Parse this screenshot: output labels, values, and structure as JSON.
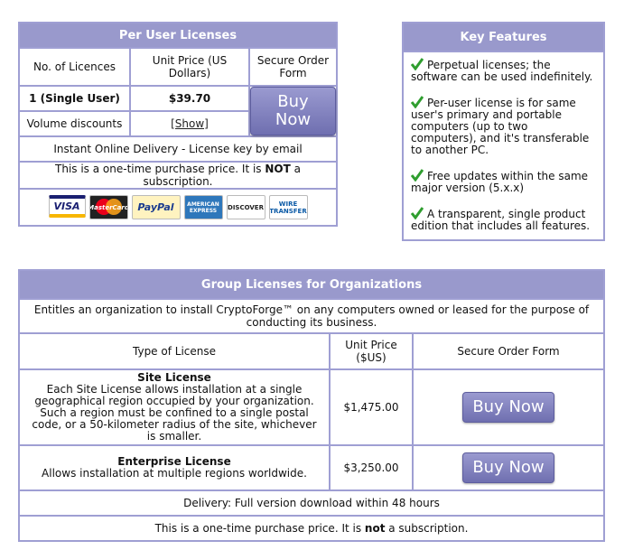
{
  "per_user": {
    "title": "Per User Licenses",
    "col_licences": "No. of Licences",
    "col_unit_price": "Unit Price (US Dollars)",
    "col_order": "Secure Order Form",
    "row_label": "1 (Single User)",
    "row_price": "$39.70",
    "buy_label": "Buy Now",
    "volume_label": "Volume discounts",
    "show_link": "[Show]",
    "delivery": "Instant Online Delivery - License key by email",
    "onetime_pre": "This is a one-time purchase price. It is ",
    "onetime_bold": "NOT",
    "onetime_post": " a subscription.",
    "payment_logos": [
      {
        "icon": "visa-logo",
        "text": "VISA"
      },
      {
        "icon": "mastercard-logo",
        "text": "MasterCard"
      },
      {
        "icon": "paypal-logo",
        "text": "PayPal"
      },
      {
        "icon": "amex-logo",
        "text": "AMERICAN EXPRESS"
      },
      {
        "icon": "discover-logo",
        "text": "DISCOVER"
      },
      {
        "icon": "wire-transfer-logo",
        "text": "WIRE TRANSFER"
      }
    ]
  },
  "features": {
    "title": "Key Features",
    "items": [
      "Perpetual licenses; the software can be used indefinitely.",
      "Per-user license is for same user's primary and portable computers (up to two computers), and it's transferable to another PC.",
      "Free updates within the same major version (5.x.x)",
      "A transparent, single product edition that includes all features."
    ]
  },
  "group": {
    "title": "Group Licenses for Organizations",
    "intro": "Entitles an organization to install CryptoForge™ on any computers owned or leased for the purpose of conducting its business.",
    "col_type": "Type of License",
    "col_price": "Unit Price ($US)",
    "col_order": "Secure Order Form",
    "site_title": "Site License",
    "site_desc": "Each Site License allows installation at a single geographical region occupied by your organization. Such a region must be confined to a single postal code, or a 50-kilometer radius of the site, whichever is smaller.",
    "site_price": "$1,475.00",
    "enterprise_title": "Enterprise License",
    "enterprise_desc": "Allows installation at multiple regions worldwide.",
    "enterprise_price": "$3,250.00",
    "buy_label": "Buy Now",
    "delivery": "Delivery: Full version download within 48 hours",
    "onetime_pre": "This is a one-time purchase price. It is ",
    "onetime_bold": "not",
    "onetime_post": " a subscription."
  },
  "colors": {
    "header_bg": "#9999cc",
    "border": "#9f9fd3",
    "check_green": "#2f9e2f"
  }
}
